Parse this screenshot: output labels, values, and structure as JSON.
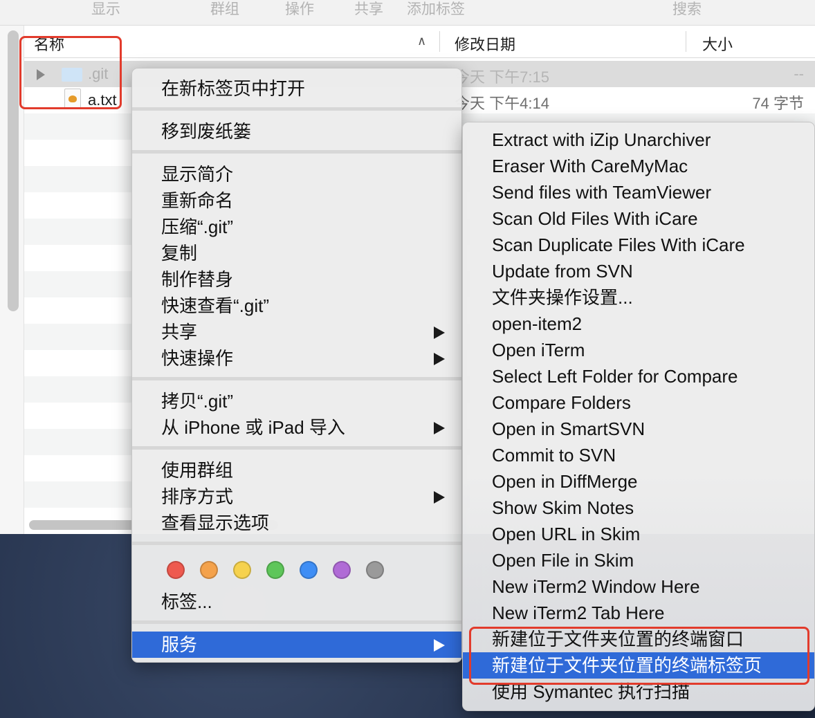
{
  "toolbar": {
    "items": [
      "显示",
      "群组",
      "操作",
      "共享",
      "添加标签",
      "搜索"
    ]
  },
  "columns": {
    "name": "名称",
    "date": "修改日期",
    "size": "大小",
    "sort_icon": "chevron-up-icon"
  },
  "files": [
    {
      "name": ".git",
      "date": "今天 下午7:15",
      "size": "--",
      "icon": "folder-icon",
      "selected": true
    },
    {
      "name": "a.txt",
      "date": "今天 下午4:14",
      "size": "74 字节",
      "icon": "text-file-icon",
      "selected": false
    }
  ],
  "context_menu": {
    "group1": [
      "在新标签页中打开"
    ],
    "group2": [
      "移到废纸篓"
    ],
    "group3": [
      "显示简介",
      "重新命名",
      "压缩“.git”",
      "复制",
      "制作替身",
      "快速查看“.git”",
      "共享",
      "快速操作"
    ],
    "group4": [
      "拷贝“.git”",
      "从 iPhone 或 iPad 导入"
    ],
    "group5": [
      "使用群组",
      "排序方式",
      "查看显示选项"
    ],
    "tags_label": "标签...",
    "tag_colors": [
      "#ee5a4f",
      "#f4a24b",
      "#f6d24e",
      "#5ec65a",
      "#3f8ef5",
      "#b06bd6",
      "#9a9a9a"
    ],
    "services": "服务"
  },
  "services_menu": {
    "items": [
      "Extract with iZip Unarchiver",
      "Eraser With CareMyMac",
      "Send files with TeamViewer",
      "Scan Old Files With iCare",
      "Scan Duplicate Files With iCare",
      "Update from SVN",
      "文件夹操作设置...",
      "open-item2",
      "Open iTerm",
      "Select Left Folder for Compare",
      "Compare Folders",
      "Open in SmartSVN",
      "Commit to SVN",
      "Open in DiffMerge",
      "Show Skim Notes",
      "Open URL in Skim",
      "Open File in Skim",
      "New iTerm2 Window Here",
      "New iTerm2 Tab Here",
      "新建位于文件夹位置的终端窗口",
      "新建位于文件夹位置的终端标签页",
      "使用 Symantec 执行扫描"
    ],
    "highlighted_index": 20
  },
  "colors": {
    "highlight": "#2f6ad8",
    "annotation": "#e23b2c"
  }
}
